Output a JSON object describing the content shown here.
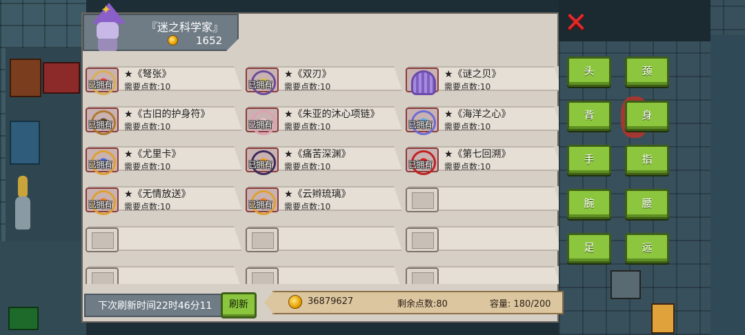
{
  "npc": {
    "title": "『迷之科学家』",
    "coins": "1652"
  },
  "owned_label": "已拥有",
  "items": [
    {
      "name": "★《弩张》",
      "cost": "需要点数:10",
      "owned": true,
      "icon": "amulet-red-icon"
    },
    {
      "name": "★《双刃》",
      "cost": "需要点数:10",
      "owned": true,
      "icon": "amulet-purple-icon"
    },
    {
      "name": "★《谜之贝》",
      "cost": "需要点数:10",
      "owned": false,
      "icon": "shell-icon"
    },
    {
      "name": "★《古旧的护身符》",
      "cost": "需要点数:10",
      "owned": true,
      "icon": "amulet-brown-icon"
    },
    {
      "name": "★《朱亚的沐心项链》",
      "cost": "需要点数:10",
      "owned": true,
      "icon": "necklace-pink-icon"
    },
    {
      "name": "★《海洋之心》",
      "cost": "需要点数:10",
      "owned": true,
      "icon": "necklace-blue-icon"
    },
    {
      "name": "★《尤里卡》",
      "cost": "需要点数:10",
      "owned": true,
      "icon": "amulet-triangle-icon"
    },
    {
      "name": "★《痛苦深渊》",
      "cost": "需要点数:10",
      "owned": true,
      "icon": "amulet-dark-icon"
    },
    {
      "name": "★《第七回溯》",
      "cost": "需要点数:10",
      "owned": true,
      "icon": "necklace-red-icon"
    },
    {
      "name": "★《无情放送》",
      "cost": "需要点数:10",
      "owned": true,
      "icon": "amulet-gold-icon"
    },
    {
      "name": "★《云辫琉璃》",
      "cost": "需要点数:10",
      "owned": true,
      "icon": "amulet-orange-icon"
    }
  ],
  "empty_slot_count": 7,
  "footer": {
    "refresh_time": "下次刷新时间22时46分11",
    "refresh_button": "刷新",
    "coins": "36879627",
    "remaining_points": "剩余点数:80",
    "capacity": "容量: 180/200"
  },
  "categories": [
    "头",
    "颈",
    "背",
    "身",
    "手",
    "指",
    "腕",
    "腰",
    "足",
    "远"
  ],
  "colors": {
    "accent_green": "#8cc63e",
    "close_red": "#e02a2a",
    "panel_bg": "#d6cfc6"
  }
}
